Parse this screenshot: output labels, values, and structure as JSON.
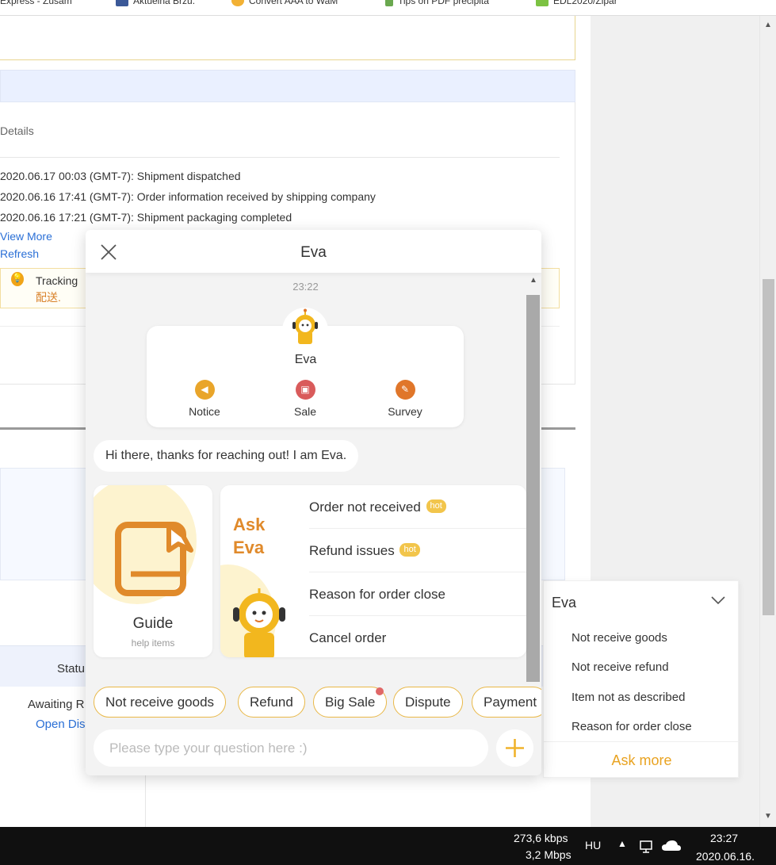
{
  "bookmarks": [
    "Express - Zusam",
    "Aktuelna Brzu.",
    "Convert AAA to WaM",
    "Tips on PDF precipita",
    "EDL2020/Zipar"
  ],
  "order": {
    "details_label": "Details",
    "events": [
      "2020.06.17 00:03 (GMT-7): Shipment dispatched",
      "2020.06.16 17:41 (GMT-7): Order information received by shipping company",
      "2020.06.16 17:21 (GMT-7): Shipment packaging completed"
    ],
    "view_more": "View More",
    "refresh": "Refresh",
    "tracking_text": "Tracking",
    "tracking_sub": "配送."
  },
  "table": {
    "status_header": "Statu",
    "status_value": "Awaiting R",
    "open_dispute": "Open Dis"
  },
  "eva_menu": {
    "title": "Eva",
    "items": [
      "Not receive goods",
      "Not receive refund",
      "Item not as described",
      "Reason for order close"
    ],
    "ask_more": "Ask more",
    "accent": "#e9a321"
  },
  "chat": {
    "title": "Eva",
    "time": "23:22",
    "bot_name": "Eva",
    "card_buttons": [
      {
        "label": "Notice",
        "icon": "megaphone-icon",
        "color": "#e9a52a"
      },
      {
        "label": "Sale",
        "icon": "shopping-bag-icon",
        "color": "#d95b5b"
      },
      {
        "label": "Survey",
        "icon": "edit-note-icon",
        "color": "#e0762a"
      }
    ],
    "greeting": "Hi there, thanks for reaching out! I am Eva.",
    "guide": {
      "title": "Guide",
      "subtitle": "help items"
    },
    "ask": {
      "title": "Ask Eva",
      "items": [
        {
          "label": "Order not received",
          "badge": "hot"
        },
        {
          "label": "Refund issues",
          "badge": "hot"
        },
        {
          "label": "Reason for order close",
          "badge": ""
        },
        {
          "label": "Cancel order",
          "badge": ""
        }
      ]
    },
    "chips": [
      "Not receive goods",
      "Refund",
      "Big Sale",
      "Dispute",
      "Payment"
    ],
    "input_placeholder": "Please type your question here :)"
  },
  "taskbar": {
    "upload": "273,6 kbps",
    "download": "3,2 Mbps",
    "language": "HU",
    "time": "23:27",
    "date": "2020.06.16."
  }
}
